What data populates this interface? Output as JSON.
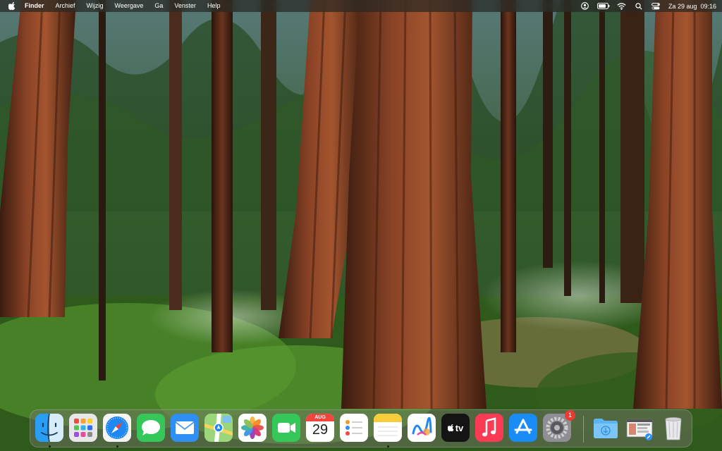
{
  "menubar": {
    "app_name": "Finder",
    "menus": [
      "Archief",
      "Wijzig",
      "Weergave",
      "Ga",
      "Venster",
      "Help"
    ],
    "status_icons": [
      "user-icon",
      "battery-icon",
      "wifi-icon",
      "search-icon",
      "control-center-icon"
    ],
    "clock": {
      "date": "Za 29 aug",
      "time": "09:16"
    }
  },
  "dock": {
    "apps": [
      {
        "name": "Finder",
        "running": true
      },
      {
        "name": "Launchpad",
        "running": false
      },
      {
        "name": "Safari",
        "running": true
      },
      {
        "name": "Berichten",
        "running": false
      },
      {
        "name": "Mail",
        "running": false
      },
      {
        "name": "Kaarten",
        "running": false
      },
      {
        "name": "Foto's",
        "running": false
      },
      {
        "name": "FaceTime",
        "running": false
      },
      {
        "name": "Agenda",
        "running": false,
        "month": "AUG",
        "day": "29"
      },
      {
        "name": "Herinneringen",
        "running": false
      },
      {
        "name": "Notities",
        "running": true
      },
      {
        "name": "Freeform",
        "running": false
      },
      {
        "name": "TV",
        "running": false,
        "label": "tv"
      },
      {
        "name": "Muziek",
        "running": false
      },
      {
        "name": "App Store",
        "running": false
      },
      {
        "name": "Systeeminstellingen",
        "running": false,
        "badge": "1"
      }
    ],
    "stacks": [
      {
        "name": "Downloads"
      },
      {
        "name": "Recente screenshot"
      },
      {
        "name": "Prullenmand"
      }
    ]
  },
  "colors": {
    "menubar_bg": "#2a2a24",
    "badge": "#e83b34",
    "accent_blue": "#1e88f5"
  }
}
